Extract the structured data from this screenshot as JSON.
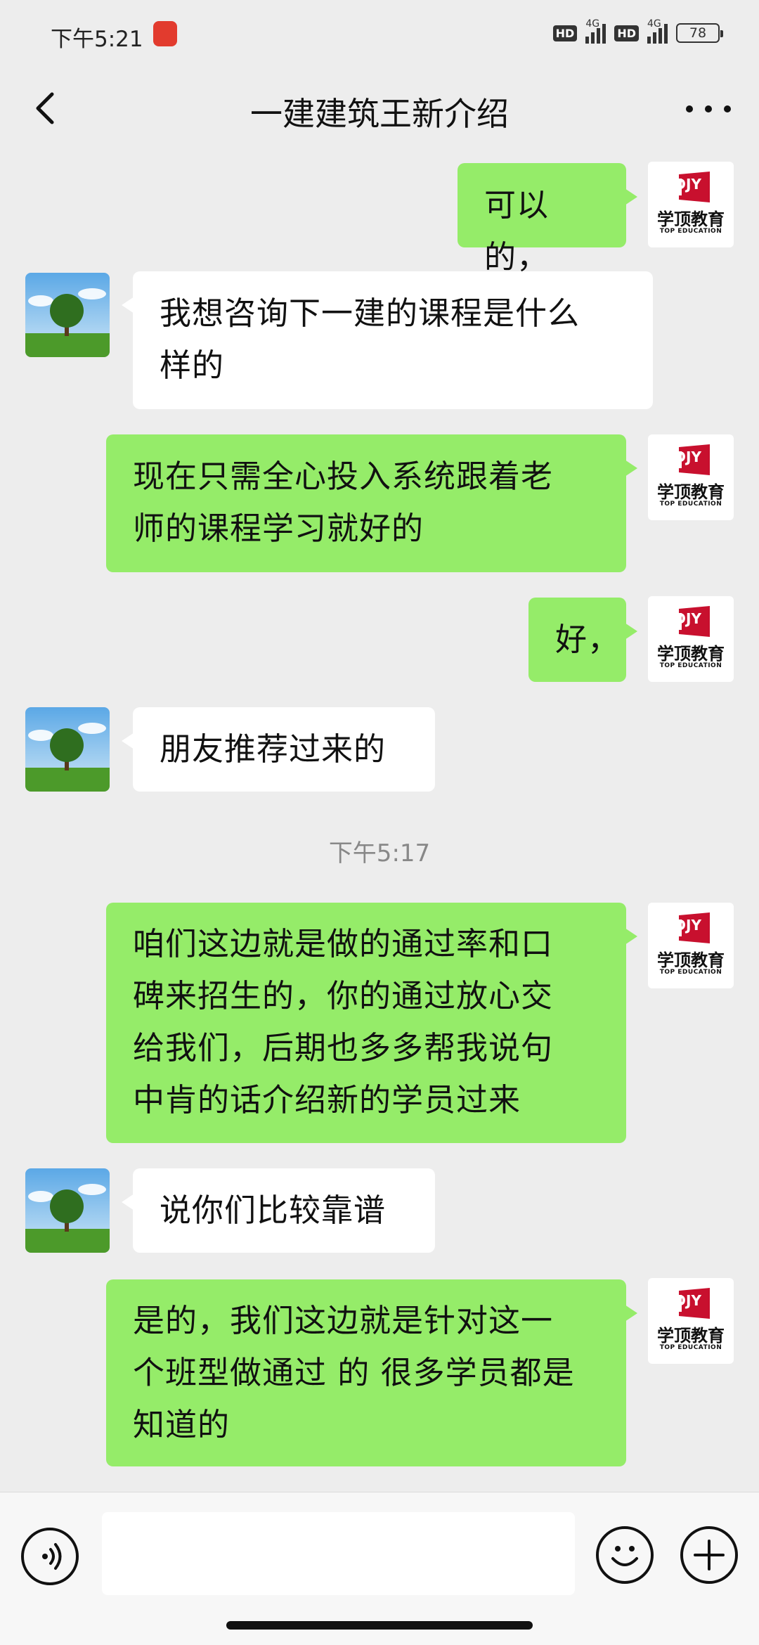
{
  "status_bar": {
    "time": "下午5:21",
    "hd_label": "HD",
    "network": "4G",
    "battery": "78"
  },
  "header": {
    "title": "一建建筑王新介绍"
  },
  "logo": {
    "mark": "XDJY",
    "cn": "学顶教育",
    "en": "TOP EDUCATION"
  },
  "messages": [
    {
      "side": "sent",
      "lines": [
        "可以的，"
      ]
    },
    {
      "side": "received",
      "lines": [
        "我想咨询下一建的课程是什么",
        "样的"
      ]
    },
    {
      "side": "sent",
      "lines": [
        "现在只需全心投入系统跟着老",
        "师的课程学习就好的"
      ]
    },
    {
      "side": "sent",
      "lines": [
        "好，"
      ]
    },
    {
      "side": "received",
      "lines": [
        "朋友推荐过来的"
      ]
    },
    {
      "side": "sent",
      "lines": [
        "咱们这边就是做的通过率和口",
        "碑来招生的，你的通过放心交",
        "给我们，后期也多多帮我说句",
        "中肯的话介绍新的学员过来"
      ]
    },
    {
      "side": "received",
      "lines": [
        "说你们比较靠谱"
      ]
    },
    {
      "side": "sent",
      "lines": [
        "是的，我们这边就是针对这一",
        "个班型做通过 的 很多学员都是",
        "知道的"
      ]
    }
  ],
  "timestamp": "下午5:17",
  "input_bar": {
    "text_value": ""
  },
  "icons": {
    "back": "chevron-left-icon",
    "more": "more-dots-icon",
    "voice": "voice-icon",
    "emoji": "emoji-icon",
    "plus": "plus-icon"
  },
  "colors": {
    "background": "#ededed",
    "sent_bubble": "#95ec69",
    "received_bubble": "#ffffff",
    "logo_red": "#c8102e"
  }
}
